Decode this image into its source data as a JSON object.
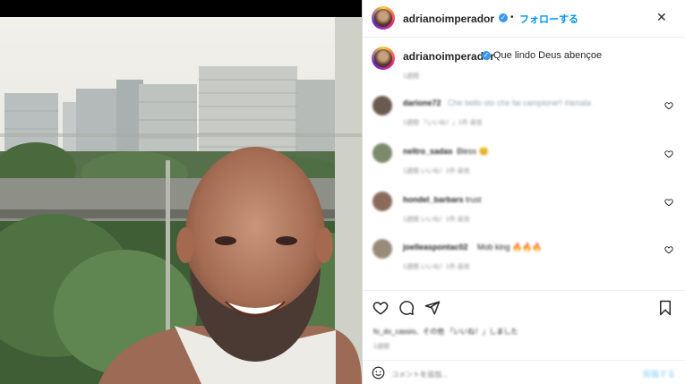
{
  "header": {
    "username": "adrianoimperador",
    "follow_label": "フォローする",
    "separator": "•",
    "more_icon": "ellipsis-icon"
  },
  "caption": {
    "username": "adrianoimperador",
    "text": "Que lindo Deus abençoe",
    "time": "1週間"
  },
  "comments": [
    {
      "user": "darione72",
      "text": "Che bello sto che fai campione!! #amala",
      "meta": "1週間  「いいね！」1件  返信"
    },
    {
      "user": "neltro_sadas",
      "text": "Bless 😊",
      "meta": "1週間  いいね！1件  返信"
    },
    {
      "user": "hondel_barbars",
      "text": "trust",
      "meta": "1週間  いいね！1件  返信"
    },
    {
      "user": "joelleaspontac02",
      "text": "Mob king 🔥🔥🔥",
      "meta": "1週間  いいね！1件  返信"
    }
  ],
  "likes": {
    "text": "fo_do_cassio、その他 「いいね！」しました",
    "time": "1週間"
  },
  "add_comment": {
    "placeholder": "コメントを追加...",
    "post_label": "投稿する"
  },
  "colors": {
    "accent": "#0095f6",
    "verified": "#3897f0",
    "text": "#262626",
    "muted": "#8e8e8e"
  }
}
